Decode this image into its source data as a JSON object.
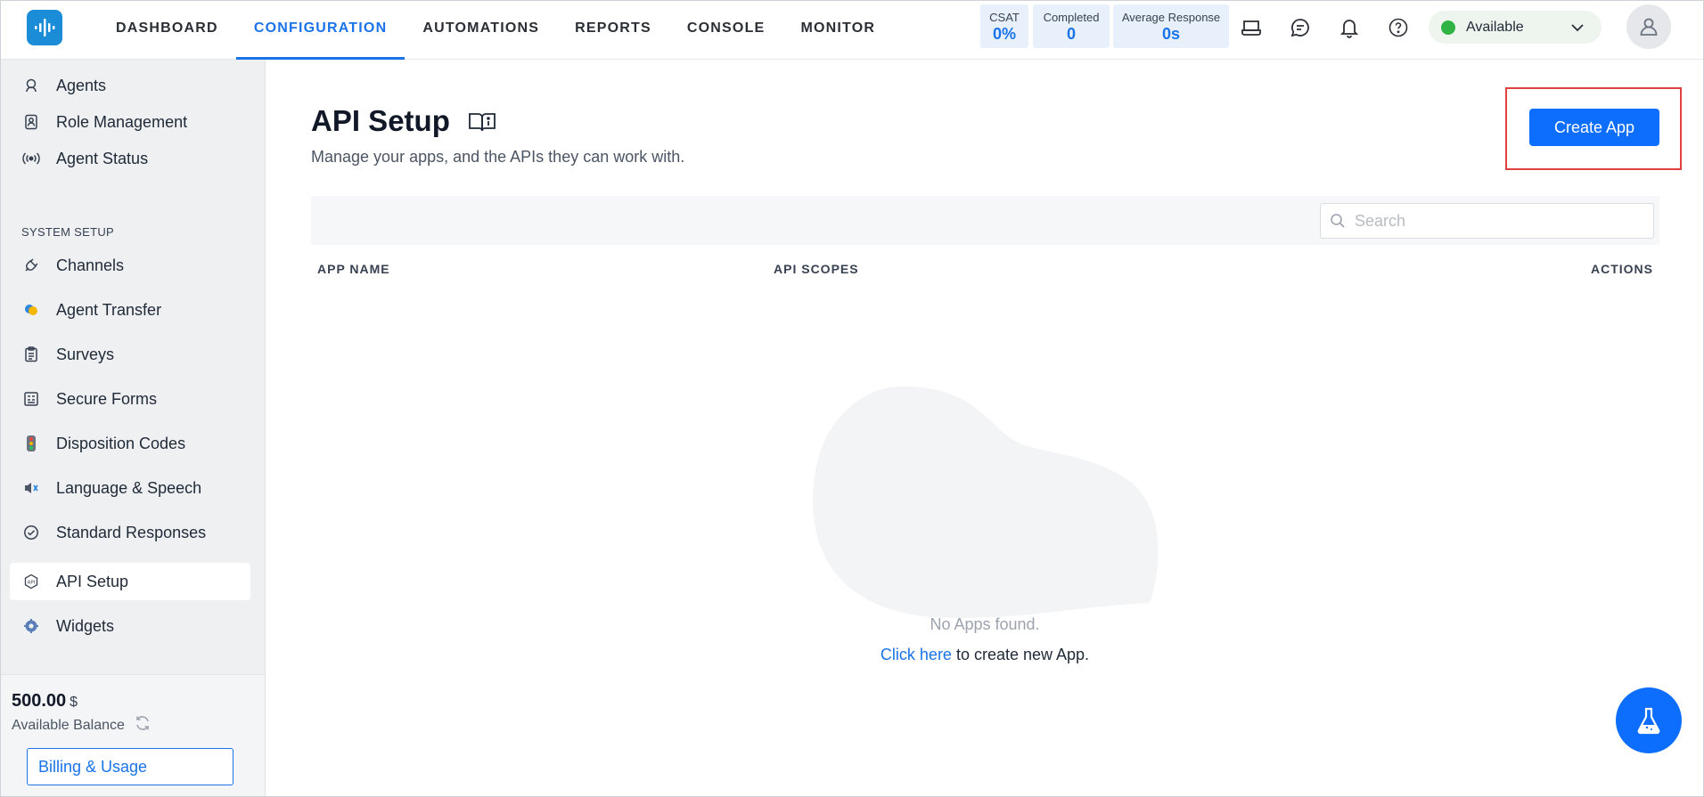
{
  "nav": {
    "tabs": [
      {
        "label": "DASHBOARD"
      },
      {
        "label": "CONFIGURATION"
      },
      {
        "label": "AUTOMATIONS"
      },
      {
        "label": "REPORTS"
      },
      {
        "label": "CONSOLE"
      },
      {
        "label": "MONITOR"
      }
    ],
    "active_tab": "CONFIGURATION"
  },
  "stats": {
    "csat": {
      "label": "CSAT",
      "value": "0%"
    },
    "completed": {
      "label": "Completed",
      "value": "0"
    },
    "avg_response": {
      "label": "Average Response",
      "value": "0s"
    }
  },
  "header_icons": [
    "inbox-icon",
    "chat-icon",
    "bell-icon",
    "help-icon"
  ],
  "agent_status": {
    "label": "Available",
    "color": "#2fb344"
  },
  "sidebar": {
    "items_top": [
      {
        "label": "Agents",
        "icon": "agents-icon"
      },
      {
        "label": "Role Management",
        "icon": "badge-icon"
      },
      {
        "label": "Agent Status",
        "icon": "broadcast-icon"
      }
    ],
    "section_label": "SYSTEM SETUP",
    "items": [
      {
        "label": "Channels",
        "icon": "plug-icon"
      },
      {
        "label": "Agent Transfer",
        "icon": "transfer-icon"
      },
      {
        "label": "Surveys",
        "icon": "clipboard-icon"
      },
      {
        "label": "Secure Forms",
        "icon": "form-icon"
      },
      {
        "label": "Disposition Codes",
        "icon": "traffic-light-icon"
      },
      {
        "label": "Language & Speech",
        "icon": "speaker-icon"
      },
      {
        "label": "Standard Responses",
        "icon": "check-circle-icon"
      },
      {
        "label": "API Setup",
        "icon": "api-icon",
        "active": true
      },
      {
        "label": "Widgets",
        "icon": "widget-gear-icon"
      }
    ],
    "balance": {
      "amount": "500.00",
      "currency": "$",
      "label": "Available Balance"
    },
    "billing_button": "Billing & Usage"
  },
  "main": {
    "title": "API Setup",
    "subtitle": "Manage your apps, and the APIs they can work with.",
    "create_button": "Create App",
    "search_placeholder": "Search",
    "columns": {
      "app_name": "APP NAME",
      "api_scopes": "API SCOPES",
      "actions": "ACTIONS"
    },
    "empty_message": "No Apps found.",
    "empty_link": "Click here",
    "empty_link_suffix": " to create new App."
  },
  "colors": {
    "accent": "#1a73e8",
    "primary_button": "#0d6efd",
    "highlight": "#e04040",
    "sidebar_bg": "#eef0f2"
  }
}
